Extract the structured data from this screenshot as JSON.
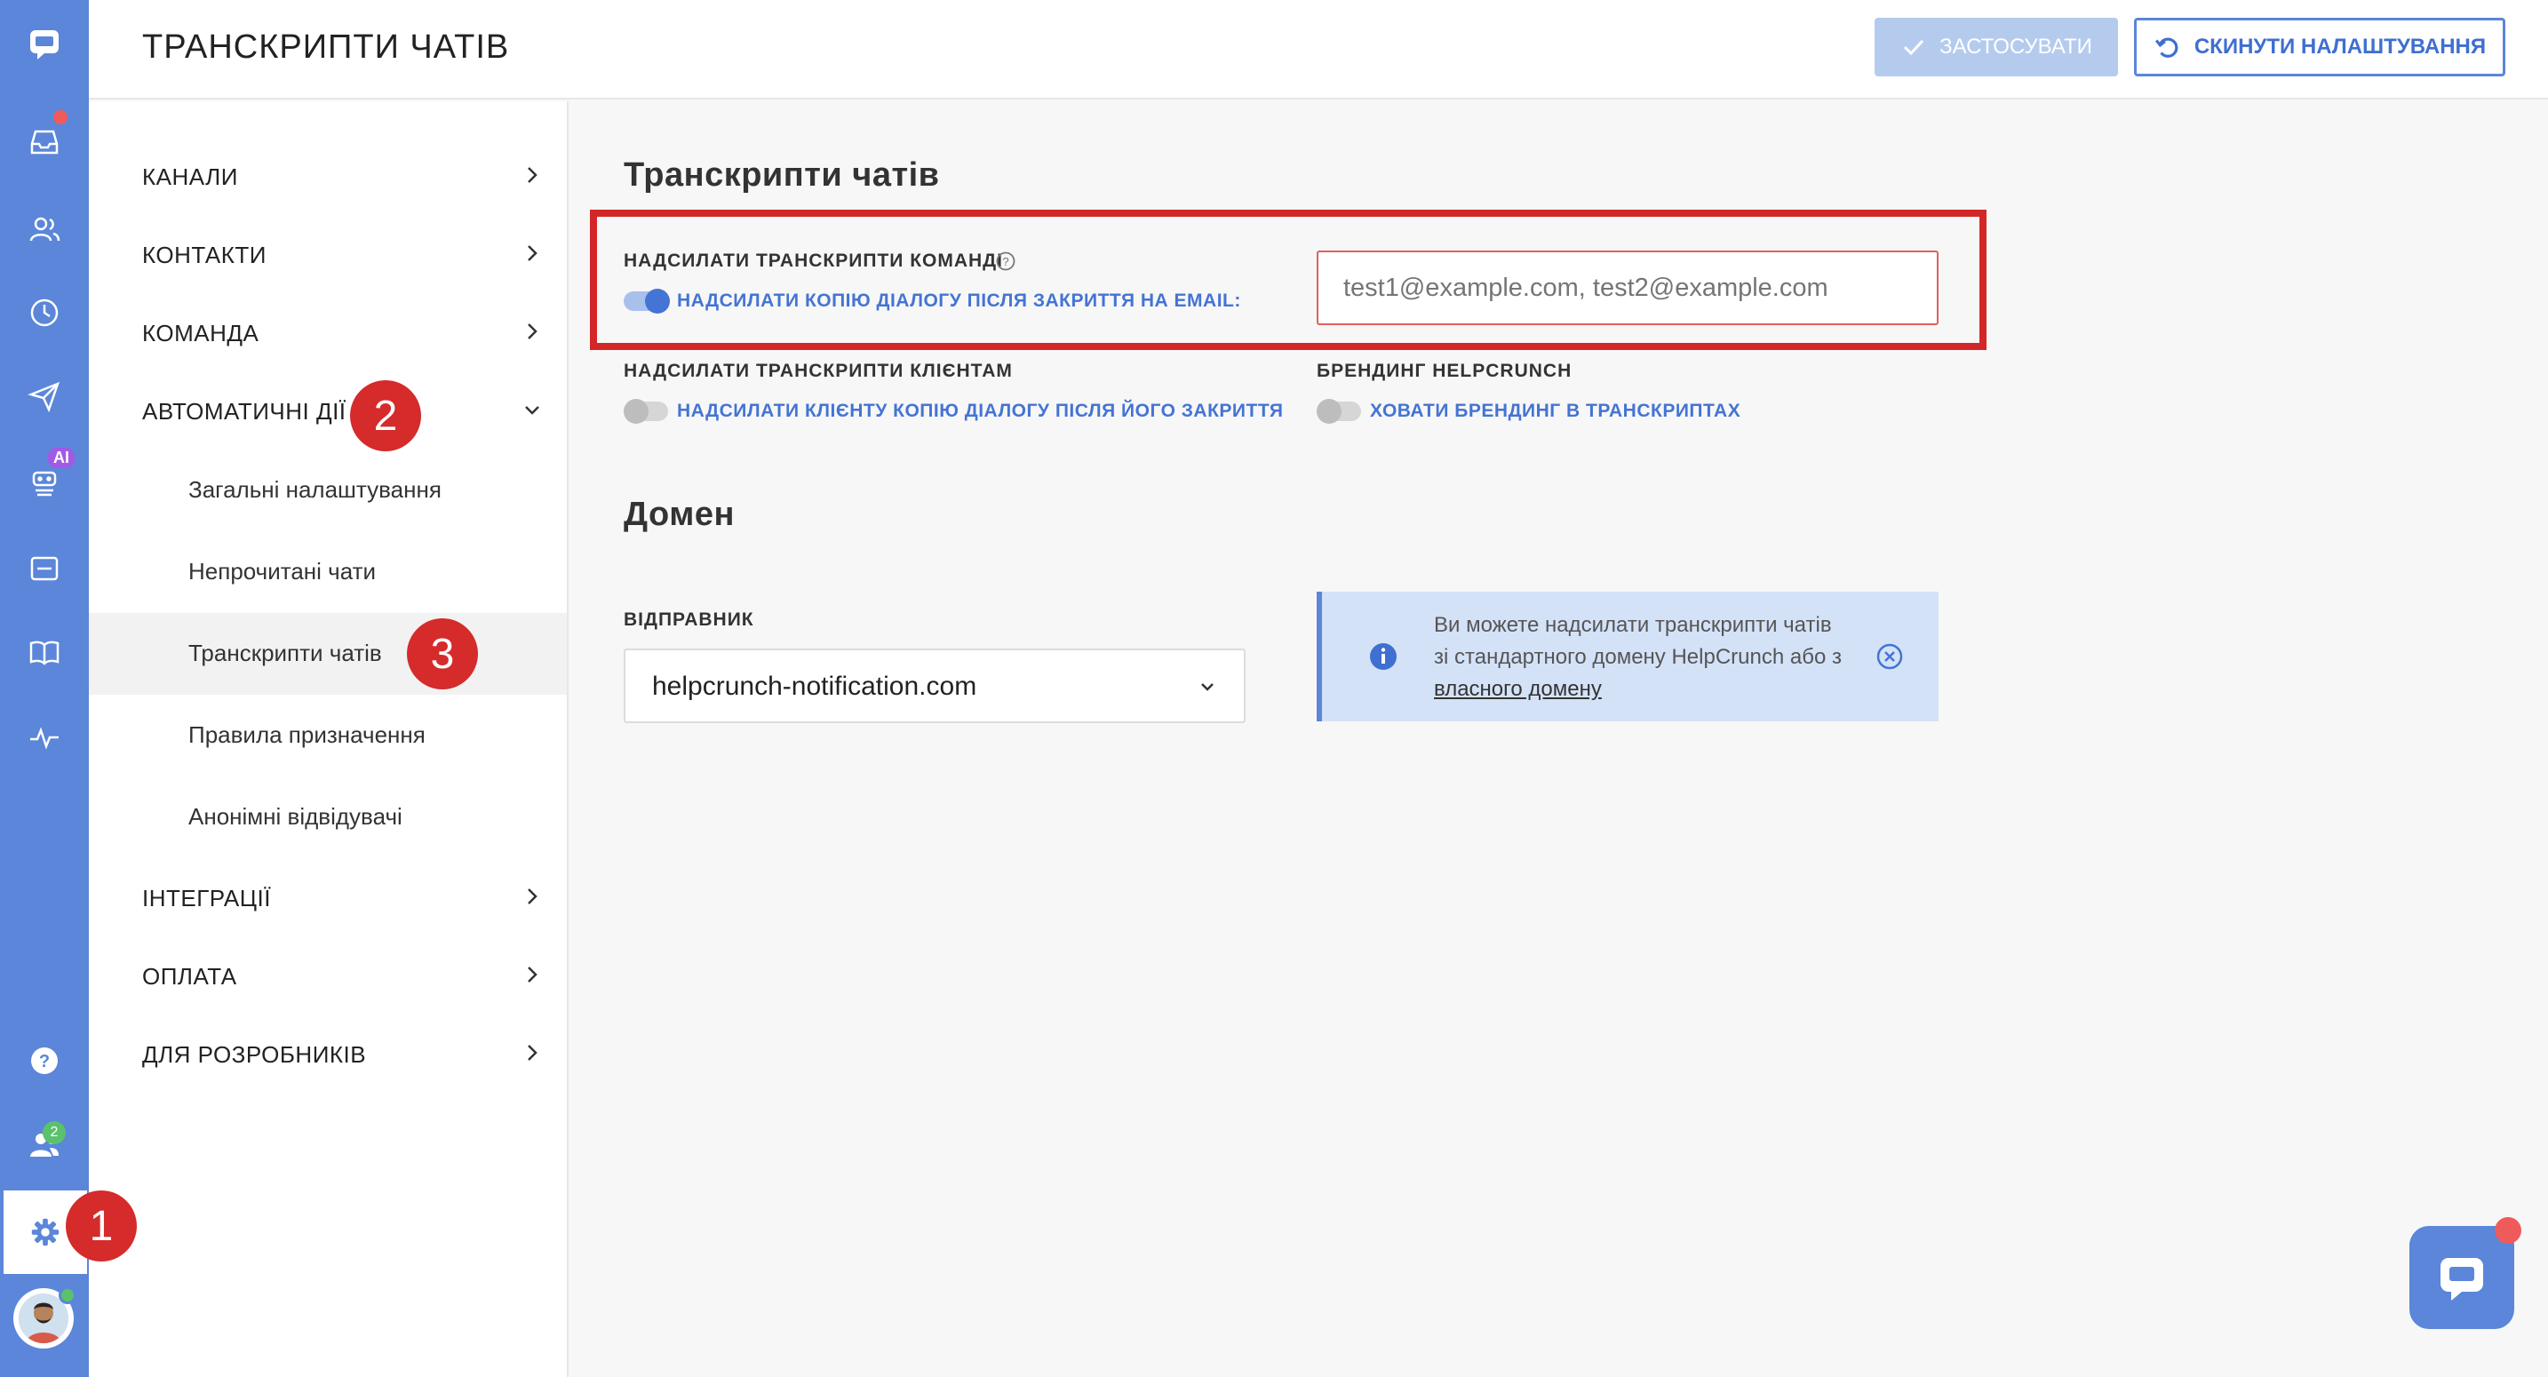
{
  "header": {
    "title": "ТРАНСКРИПТИ ЧАТІВ",
    "apply_label": "ЗАСТОСУВАТИ",
    "reset_label": "СКИНУТИ НАЛАШТУВАННЯ"
  },
  "rail": {
    "ai_badge": "AI",
    "team_count": "2",
    "icons": [
      "logo-chat-icon",
      "inbox-icon",
      "contacts-icon",
      "history-icon",
      "send-icon",
      "ai-bot-icon",
      "widget-icon",
      "book-icon",
      "activity-icon",
      "help-icon",
      "team-icon",
      "gear-icon",
      "avatar"
    ]
  },
  "nav": {
    "items": [
      {
        "label": "КАНАЛИ"
      },
      {
        "label": "КОНТАКТИ"
      },
      {
        "label": "КОМАНДА"
      },
      {
        "label": "АВТОМАТИЧНІ ДІЇ",
        "expanded": true
      },
      {
        "label": "ІНТЕГРАЦІЇ"
      },
      {
        "label": "ОПЛАТА"
      },
      {
        "label": "ДЛЯ РОЗРОБНИКІВ"
      }
    ],
    "sub_items": [
      {
        "label": "Загальні налаштування"
      },
      {
        "label": "Непрочитані чати"
      },
      {
        "label": "Транскрипти чатів",
        "active": true
      },
      {
        "label": "Правила призначення"
      },
      {
        "label": "Анонімні відвідувачі"
      }
    ]
  },
  "markers": [
    "1",
    "2",
    "3"
  ],
  "content": {
    "section1_title": "Транскрипти чатів",
    "team_label": "НАДСИЛАТИ ТРАНСКРИПТИ КОМАНДІ",
    "team_toggle_label": "НАДСИЛАТИ КОПІЮ ДІАЛОГУ ПІСЛЯ ЗАКРИТТЯ НА EMAIL:",
    "team_toggle_on": true,
    "email_placeholder": "test1@example.com, test2@example.com",
    "client_label": "НАДСИЛАТИ ТРАНСКРИПТИ КЛІЄНТАМ",
    "client_toggle_label": "НАДСИЛАТИ КЛІЄНТУ КОПІЮ ДІАЛОГУ ПІСЛЯ ЙОГО ЗАКРИТТЯ",
    "client_toggle_on": false,
    "branding_label": "БРЕНДИНГ HELPCRUNCH",
    "branding_toggle_label": "ХОВАТИ БРЕНДИНГ В ТРАНСКРИПТАХ",
    "branding_toggle_on": false,
    "section2_title": "Домен",
    "sender_label": "ВІДПРАВНИК",
    "sender_value": "helpcrunch-notification.com",
    "info_text": "Ви можете надсилати транскрипти чатів зі стандартного домену HelpCrunch або з ",
    "info_link": "власного домену"
  },
  "colors": {
    "rail": "#5b86d9",
    "accent": "#4474d4",
    "highlight": "#d32727",
    "marker": "#d52b2b"
  }
}
